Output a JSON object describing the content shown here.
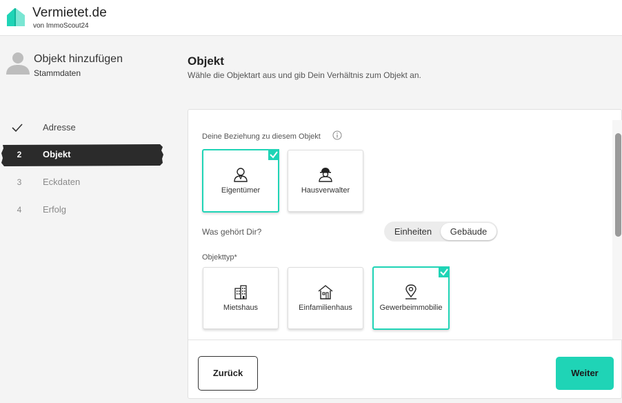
{
  "brand": {
    "title": "Vermietet.de",
    "subtitle": "von ImmoScout24"
  },
  "sidebar": {
    "title": "Objekt hinzufügen",
    "subtitle": "Stammdaten",
    "steps": [
      {
        "num": "",
        "label": "Adresse",
        "state": "done"
      },
      {
        "num": "2",
        "label": "Objekt",
        "state": "active"
      },
      {
        "num": "3",
        "label": "Eckdaten",
        "state": "pending"
      },
      {
        "num": "4",
        "label": "Erfolg",
        "state": "pending"
      }
    ]
  },
  "main": {
    "title": "Objekt",
    "subtitle": "Wähle die Objektart aus und gib Dein Verhältnis zum Objekt an."
  },
  "form": {
    "relation_label": "Deine Beziehung zu diesem Objekt",
    "relation_options": [
      {
        "label": "Eigentümer",
        "icon": "owner-icon",
        "selected": true
      },
      {
        "label": "Hausverwalter",
        "icon": "property-manager-icon",
        "selected": false
      }
    ],
    "ownership_question": "Was gehört Dir?",
    "ownership_toggle": {
      "options": [
        "Einheiten",
        "Gebäude"
      ],
      "selected": "Gebäude"
    },
    "type_label": "Objekttyp*",
    "type_options": [
      {
        "label": "Mietshaus",
        "icon": "apartment-building-icon",
        "selected": false
      },
      {
        "label": "Einfamilienhaus",
        "icon": "house-icon",
        "selected": false
      },
      {
        "label": "Gewerbeimmobilie",
        "icon": "location-pin-icon",
        "selected": true
      }
    ]
  },
  "buttons": {
    "back": "Zurück",
    "next": "Weiter"
  },
  "colors": {
    "accent": "#1fd4b6",
    "active_step_bg": "#2b2b2b"
  }
}
